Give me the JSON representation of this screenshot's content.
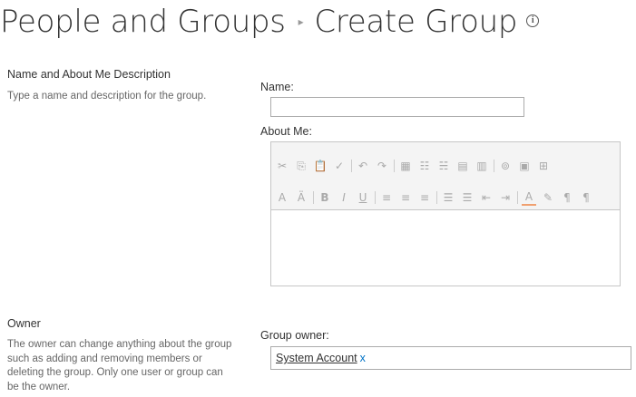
{
  "header": {
    "breadcrumb_root": "People and Groups",
    "page_title": "Create Group",
    "separator": "▸",
    "info": "i"
  },
  "sections": {
    "name": {
      "title": "Name and About Me Description",
      "description": "Type a name and description for the group.",
      "name_label": "Name:",
      "name_value": "",
      "about_label": "About Me:",
      "about_value": ""
    },
    "owner": {
      "title": "Owner",
      "description": "The owner can change anything about the group such as adding and removing members or deleting the group. Only one user or group can be the owner.",
      "label": "Group owner:",
      "value": "System Account",
      "remove": "x"
    }
  },
  "toolbar": {
    "row1": [
      "cut-icon",
      "copy-icon",
      "paste-icon",
      "spellcheck-icon",
      "|",
      "undo-icon",
      "redo-icon",
      "|",
      "insert-table-icon",
      "insert-row-icon",
      "insert-column-icon",
      "table-properties-icon",
      "cell-properties-icon",
      "|",
      "insert-link-icon",
      "insert-image-icon",
      "table-grid-icon"
    ],
    "row2": [
      "font-size-icon",
      "text-style-icon",
      "|",
      "bold-icon",
      "italic-icon",
      "underline-icon",
      "|",
      "align-left-icon",
      "align-center-icon",
      "align-right-icon",
      "|",
      "numbered-list-icon",
      "bullet-list-icon",
      "decrease-indent-icon",
      "increase-indent-icon",
      "|",
      "text-color-icon",
      "highlight-icon",
      "ltr-icon",
      "rtl-icon"
    ]
  }
}
